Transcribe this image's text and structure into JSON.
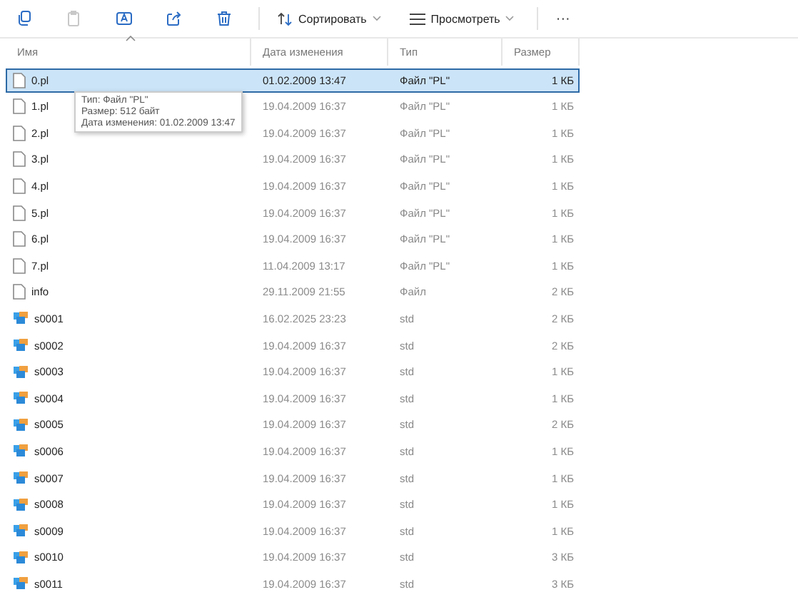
{
  "toolbar": {
    "actions": [
      {
        "kind": "copy",
        "disabled": false
      },
      {
        "kind": "paste",
        "disabled": true
      },
      {
        "kind": "rename",
        "disabled": false
      },
      {
        "kind": "share",
        "disabled": false
      },
      {
        "kind": "delete",
        "disabled": false
      }
    ],
    "sort": {
      "label": "Сортировать"
    },
    "view": {
      "label": "Просмотреть"
    },
    "more": "···"
  },
  "table": {
    "columns": [
      "Имя",
      "Дата изменения",
      "Тип",
      "Размер"
    ],
    "rows": [
      {
        "kind": "file",
        "name": "0.pl",
        "date": "01.02.2009 13:47",
        "type": "Файл \"PL\"",
        "size": "1 КБ",
        "selected": true
      },
      {
        "kind": "file",
        "name": "1.pl",
        "date": "19.04.2009 16:37",
        "type": "Файл \"PL\"",
        "size": "1 КБ",
        "selected": false
      },
      {
        "kind": "file",
        "name": "2.pl",
        "date": "19.04.2009 16:37",
        "type": "Файл \"PL\"",
        "size": "1 КБ",
        "selected": false
      },
      {
        "kind": "file",
        "name": "3.pl",
        "date": "19.04.2009 16:37",
        "type": "Файл \"PL\"",
        "size": "1 КБ",
        "selected": false
      },
      {
        "kind": "file",
        "name": "4.pl",
        "date": "19.04.2009 16:37",
        "type": "Файл \"PL\"",
        "size": "1 КБ",
        "selected": false
      },
      {
        "kind": "file",
        "name": "5.pl",
        "date": "19.04.2009 16:37",
        "type": "Файл \"PL\"",
        "size": "1 КБ",
        "selected": false
      },
      {
        "kind": "file",
        "name": "6.pl",
        "date": "19.04.2009 16:37",
        "type": "Файл \"PL\"",
        "size": "1 КБ",
        "selected": false
      },
      {
        "kind": "file",
        "name": "7.pl",
        "date": "11.04.2009 13:17",
        "type": "Файл \"PL\"",
        "size": "1 КБ",
        "selected": false
      },
      {
        "kind": "file",
        "name": "info",
        "date": "29.11.2009 21:55",
        "type": "Файл",
        "size": "2 КБ",
        "selected": false
      },
      {
        "kind": "std",
        "name": "s0001",
        "date": "16.02.2025 23:23",
        "type": "std",
        "size": "2 КБ",
        "selected": false
      },
      {
        "kind": "std",
        "name": "s0002",
        "date": "19.04.2009 16:37",
        "type": "std",
        "size": "2 КБ",
        "selected": false
      },
      {
        "kind": "std",
        "name": "s0003",
        "date": "19.04.2009 16:37",
        "type": "std",
        "size": "1 КБ",
        "selected": false
      },
      {
        "kind": "std",
        "name": "s0004",
        "date": "19.04.2009 16:37",
        "type": "std",
        "size": "1 КБ",
        "selected": false
      },
      {
        "kind": "std",
        "name": "s0005",
        "date": "19.04.2009 16:37",
        "type": "std",
        "size": "2 КБ",
        "selected": false
      },
      {
        "kind": "std",
        "name": "s0006",
        "date": "19.04.2009 16:37",
        "type": "std",
        "size": "1 КБ",
        "selected": false
      },
      {
        "kind": "std",
        "name": "s0007",
        "date": "19.04.2009 16:37",
        "type": "std",
        "size": "1 КБ",
        "selected": false
      },
      {
        "kind": "std",
        "name": "s0008",
        "date": "19.04.2009 16:37",
        "type": "std",
        "size": "1 КБ",
        "selected": false
      },
      {
        "kind": "std",
        "name": "s0009",
        "date": "19.04.2009 16:37",
        "type": "std",
        "size": "1 КБ",
        "selected": false
      },
      {
        "kind": "std",
        "name": "s0010",
        "date": "19.04.2009 16:37",
        "type": "std",
        "size": "3 КБ",
        "selected": false
      },
      {
        "kind": "std",
        "name": "s0011",
        "date": "19.04.2009 16:37",
        "type": "std",
        "size": "3 КБ",
        "selected": false
      }
    ]
  },
  "tooltip": {
    "lines": [
      "Тип: Файл \"PL\"",
      "Размер: 512 байт",
      "Дата изменения: 01.02.2009 13:47"
    ]
  }
}
